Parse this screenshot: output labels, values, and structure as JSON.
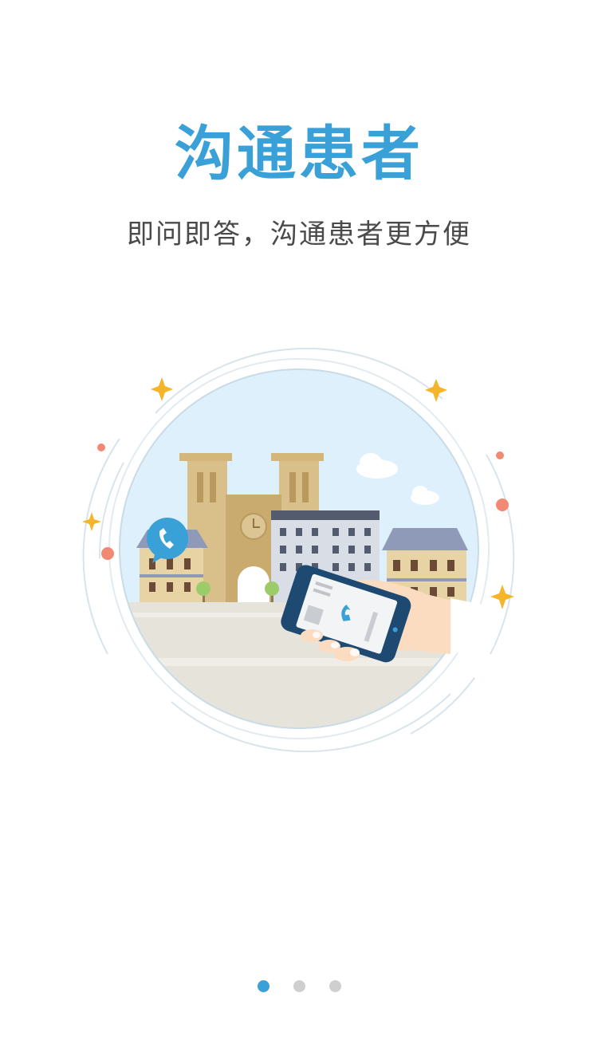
{
  "onboarding": {
    "title": "沟通患者",
    "subtitle": "即问即答，沟通患者更方便"
  },
  "pager": {
    "total": 3,
    "active_index": 0
  },
  "colors": {
    "accent": "#3aa0d8",
    "subtitle": "#4a4a4a",
    "dot_inactive": "#cfcfcf",
    "sky": "#ddf0fb",
    "ground": "#e6e3db",
    "cathedral": "#d9c08a",
    "star": "#f5b52a",
    "bubble_dot": "#f28a73"
  }
}
